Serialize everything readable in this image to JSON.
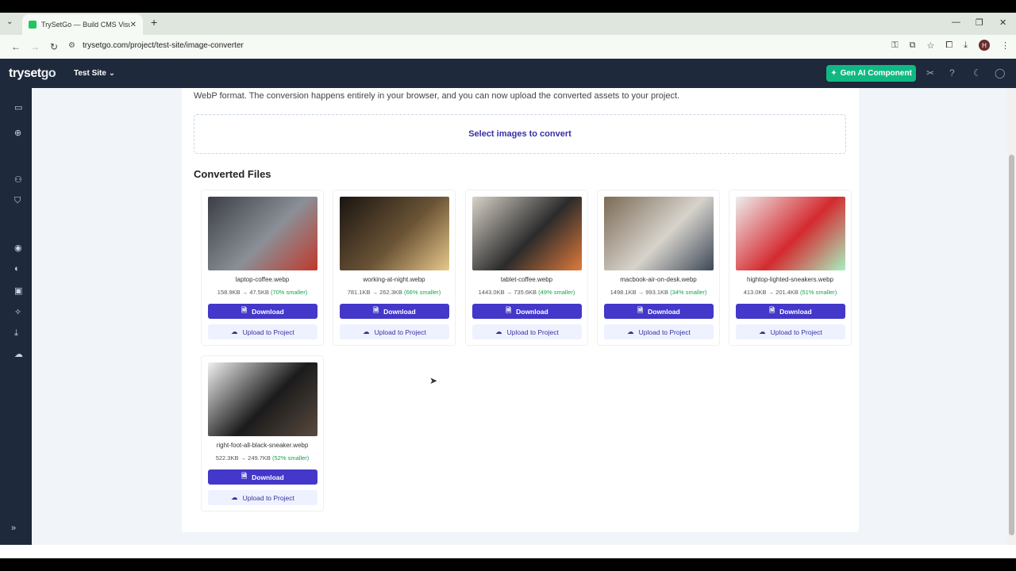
{
  "browser": {
    "tab_title": "TrySetGo — Build CMS Visually",
    "url": "trysetgo.com/project/test-site/image-converter",
    "profile_initial": "H"
  },
  "app": {
    "logo_try": "try",
    "logo_set": "set",
    "logo_go": "go",
    "site_selector": "Test Site",
    "gen_ai_label": "Gen AI Component"
  },
  "main": {
    "description": "WebP format. The conversion happens entirely in your browser, and you can now upload the converted assets to your project.",
    "dropzone_label": "Select images to convert",
    "section_title": "Converted Files",
    "download_label": "Download",
    "upload_label": "Upload to Project",
    "files": [
      {
        "name": "laptop-coffee.webp",
        "sizes": "158.9KB → 47.5KB",
        "saving": "(70% smaller)",
        "colors": [
          "#3b3f45",
          "#8b8f96",
          "#c0392b"
        ]
      },
      {
        "name": "working-at-night.webp",
        "sizes": "781.1KB → 262.3KB",
        "saving": "(66% smaller)",
        "colors": [
          "#1a1410",
          "#6b5436",
          "#e8c88a"
        ]
      },
      {
        "name": "tablet-coffee.webp",
        "sizes": "1443.0KB → 735.6KB",
        "saving": "(49% smaller)",
        "colors": [
          "#d8d2c8",
          "#2b2b2b",
          "#e07a3b"
        ]
      },
      {
        "name": "macbook-air-on-desk.webp",
        "sizes": "1498.1KB → 993.1KB",
        "saving": "(34% smaller)",
        "colors": [
          "#7b6a55",
          "#d7d3cc",
          "#3c4856"
        ]
      },
      {
        "name": "hightop-lighted-sneakers.webp",
        "sizes": "413.0KB → 201.4KB",
        "saving": "(51% smaller)",
        "colors": [
          "#eeeeee",
          "#d42a2f",
          "#a8f0c0"
        ]
      },
      {
        "name": "right-foot-all-black-sneaker.webp",
        "sizes": "522.3KB → 249.7KB",
        "saving": "(52% smaller)",
        "colors": [
          "#f0f0f0",
          "#1b1b1b",
          "#5a4a3e"
        ]
      }
    ]
  }
}
